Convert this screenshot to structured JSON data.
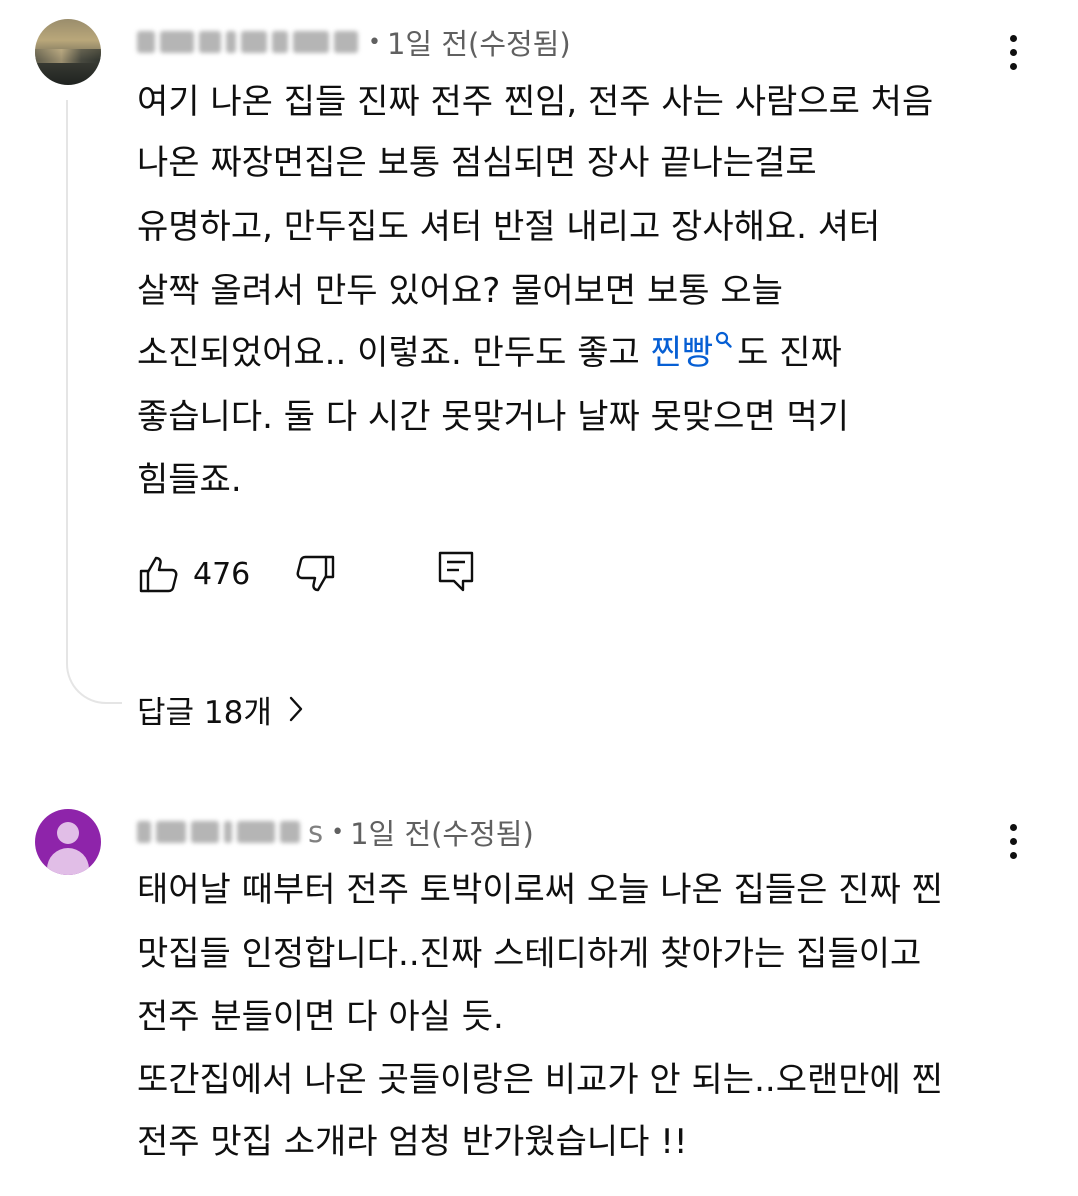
{
  "comments": [
    {
      "time": "1일 전(수정됨)",
      "separator": "•",
      "lines": [
        "여기 나온 집들 진짜 전주 찐임, 전주 사는 사람으로 처음",
        "나온 짜장면집은 보통 점심되면 장사 끝나는걸로",
        "유명하고, 만두집도 셔터 반절 내리고 장사해요. 셔터",
        "살짝 올려서 만두 있어요? 물어보면 보통 오늘"
      ],
      "line5_before": "소진되었어요.. 이렇죠. 만두도 좋고 ",
      "line5_tag": "찐빵",
      "line5_after": "도 진짜",
      "lines_end": [
        "좋습니다. 둘 다 시간 못맞거나 날짜 못맞으면 먹기",
        "힘들죠."
      ],
      "like_count": "476",
      "replies_label": "답글 18개",
      "icons": {
        "like": "thumbs-up-icon",
        "dislike": "thumbs-down-icon",
        "reply": "comment-icon",
        "menu": "more-vert-icon",
        "search": "search-icon"
      }
    },
    {
      "author_suffix": "s",
      "time": "1일 전(수정됨)",
      "separator": "•",
      "lines": [
        "태어날 때부터 전주 토박이로써 오늘 나온 집들은 진짜 찐",
        "맛집들 인정합니다..진짜 스테디하게 찾아가는 집들이고",
        "전주 분들이면 다 아실 듯.",
        "또간집에서 나온 곳들이랑은 비교가 안 되는..오랜만에 찐",
        "전주 맛집 소개라 엄청 반가웠습니다 !!"
      ]
    }
  ],
  "colors": {
    "link": "#065fd4",
    "meta": "#606060",
    "default_avatar": "#8e24aa"
  }
}
